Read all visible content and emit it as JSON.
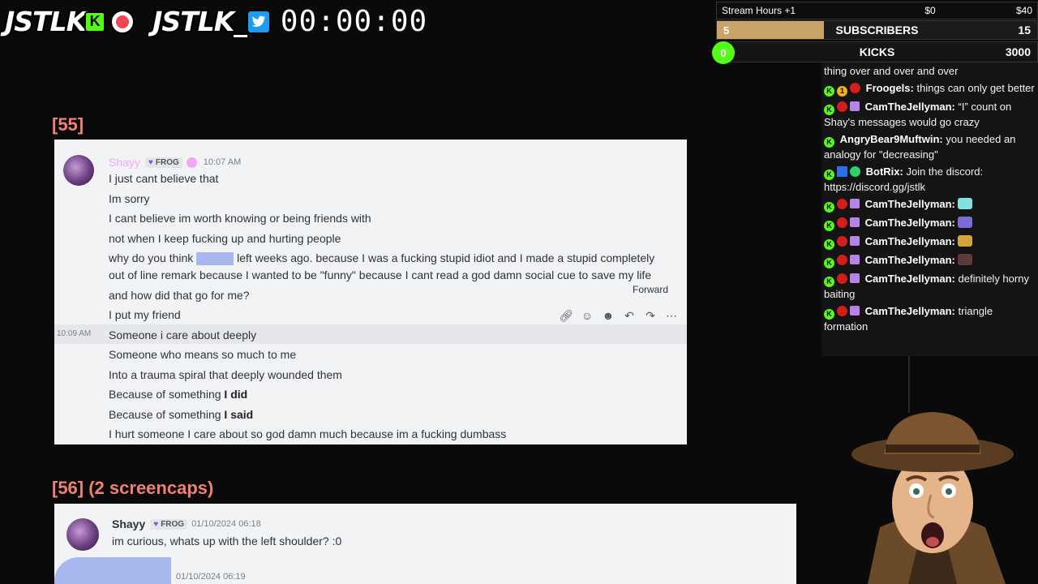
{
  "overlay": {
    "brand_kick": "JSTLK",
    "kick_letter": "K",
    "brand_twitter": "JSTLK_",
    "timer": "00:00:00"
  },
  "goals": {
    "stream_hours": "Stream Hours +1",
    "money_start": "$0",
    "money_end": "$40",
    "subscribers": {
      "label": "SUBSCRIBERS",
      "current": "5",
      "goal": "15",
      "progress": 0.333
    },
    "kicks": {
      "label": "KICKS",
      "current": "0",
      "goal": "3000",
      "progress": 0
    }
  },
  "sections": [
    {
      "label": "[55]"
    },
    {
      "label": "[56] (2 screencaps)"
    }
  ],
  "card1": {
    "username": "Shayy",
    "role": "FROG",
    "timestamp": "10:07 AM",
    "side_timestamp": "10:09 AM",
    "tooltip": "Forward",
    "lines": [
      "I just cant believe that",
      "Im sorry",
      "I cant believe im worth knowing or being friends with",
      "not when I keep fucking up and hurting people",
      "why do you think",
      "left weeks ago. because I was a fucking stupid idiot and I made a stupid completely",
      "out of line remark because I wanted to be \"funny\" because I cant read a god damn social cue to save my life",
      "and how did that go for me?",
      "I put my friend",
      "Someone i care about deeply",
      "Someone who means so much to me",
      "Into a trauma spiral that deeply wounded them",
      "Because of something",
      "I did",
      "Because of something",
      "I said",
      "I hurt someone I care about so god damn much because im a fucking dumbass"
    ]
  },
  "card2": {
    "username": "Shayy",
    "role": "FROG",
    "timestamp": "01/10/2024 06:18",
    "message": "im curious, whats up with the left shoulder? :0",
    "next_timestamp": "01/10/2024 06:19"
  },
  "chat": [
    {
      "user": "",
      "text": "thing over and over and over"
    },
    {
      "user": "Froogels:",
      "text": "things can only get better"
    },
    {
      "user": "CamTheJellyman:",
      "text": "“I” count on Shay's messages would go crazy"
    },
    {
      "user": "AngryBear9Muftwin:",
      "text": "you needed an analogy for \"decreasing\""
    },
    {
      "user": "BotRix:",
      "text": "Join the discord: https://discord.gg/jstlk"
    },
    {
      "user": "CamTheJellyman:",
      "text": ""
    },
    {
      "user": "CamTheJellyman:",
      "text": ""
    },
    {
      "user": "CamTheJellyman:",
      "text": ""
    },
    {
      "user": "CamTheJellyman:",
      "text": ""
    },
    {
      "user": "CamTheJellyman:",
      "text": "definitely horny baiting"
    },
    {
      "user": "CamTheJellyman:",
      "text": "triangle formation"
    }
  ],
  "colors": {
    "kick_green": "#53fc18",
    "subscriber_fill": "#c8a46a",
    "section_label": "#f08070",
    "discord_bg": "#f2f3f5",
    "redaction_blue": "#a6b8ee"
  },
  "icons": [
    "kick-logo-icon",
    "record-icon",
    "twitter-icon",
    "link-icon",
    "add-reaction-icon",
    "emoji-icon",
    "reply-icon",
    "forward-icon",
    "more-icon"
  ]
}
